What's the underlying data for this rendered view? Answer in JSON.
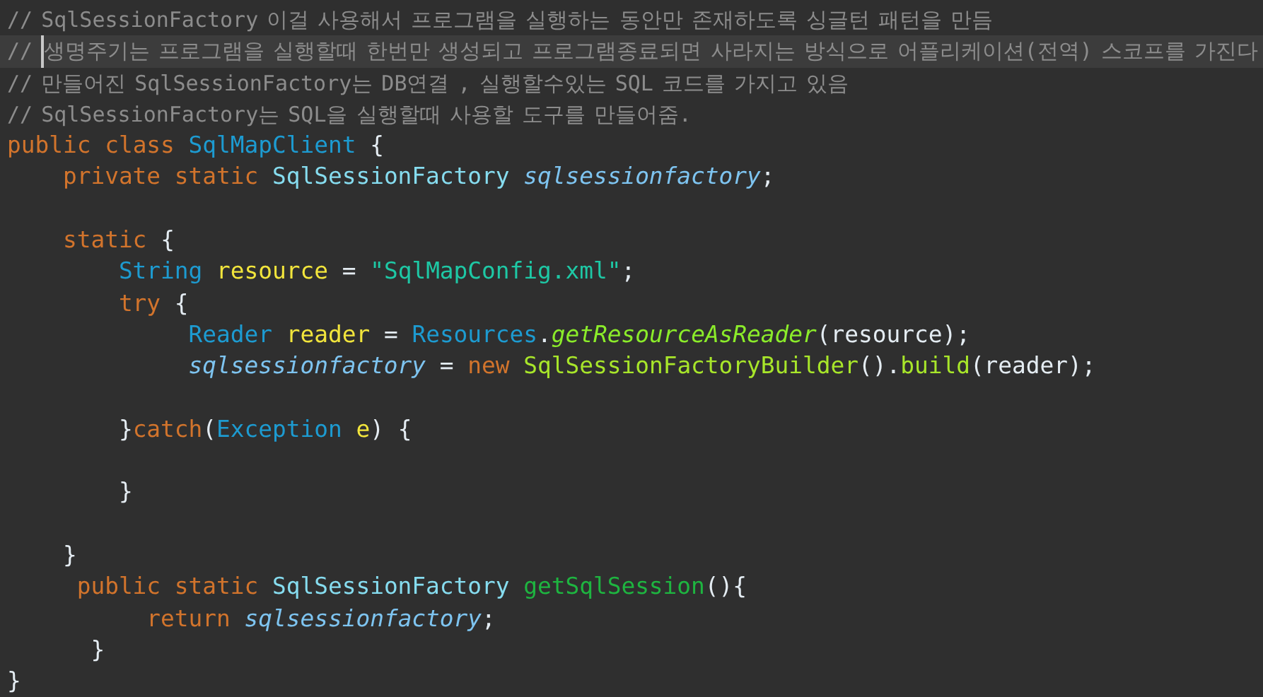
{
  "editor": {
    "lines": [
      {
        "kind": "code",
        "tokens": [
          {
            "text": "// SqlSessionFactory 이걸 사용해서 프로그램을 실행하는 동안만 존재하도록 싱글턴 패턴을 만듬",
            "kind": "comment"
          }
        ]
      },
      {
        "kind": "code",
        "current": true,
        "tokens": [
          {
            "text": "// ",
            "kind": "comment"
          },
          {
            "text": "생명주기는 프로그램을 실행할때 한번만 생성되고 프로그램종료되면 사라지는 방식으로 어플리케이션(전역) 스코프를 가진다",
            "kind": "comment",
            "caret": true
          }
        ]
      },
      {
        "kind": "code",
        "tokens": [
          {
            "text": "// 만들어진 SqlSessionFactory는 DB연결 , 실행할수있는 SQL 코드를 가지고 있음",
            "kind": "comment"
          }
        ]
      },
      {
        "kind": "code",
        "tokens": [
          {
            "text": "// SqlSessionFactory는 SQL을 실행할때 사용할 도구를 만들어줌.",
            "kind": "comment"
          }
        ]
      },
      {
        "kind": "code",
        "tokens": [
          {
            "text": "public ",
            "kind": "keyword"
          },
          {
            "text": "class ",
            "kind": "keyword"
          },
          {
            "text": "SqlMapClient",
            "kind": "class"
          },
          {
            "text": " {",
            "kind": "plain"
          }
        ]
      },
      {
        "kind": "code",
        "tokens": [
          {
            "text": "    private ",
            "kind": "keyword"
          },
          {
            "text": "static ",
            "kind": "keyword"
          },
          {
            "text": "SqlSessionFactory ",
            "kind": "interface"
          },
          {
            "text": "sqlsessionfactory",
            "kind": "field"
          },
          {
            "text": ";",
            "kind": "plain"
          }
        ]
      },
      {
        "kind": "blank"
      },
      {
        "kind": "code",
        "tokens": [
          {
            "text": "    static ",
            "kind": "keyword"
          },
          {
            "text": "{",
            "kind": "plain"
          }
        ]
      },
      {
        "kind": "code",
        "tokens": [
          {
            "text": "        String ",
            "kind": "class"
          },
          {
            "text": "resource",
            "kind": "variable"
          },
          {
            "text": " = ",
            "kind": "plain"
          },
          {
            "text": "\"SqlMapConfig.xml\"",
            "kind": "string"
          },
          {
            "text": ";",
            "kind": "plain"
          }
        ]
      },
      {
        "kind": "code",
        "tokens": [
          {
            "text": "        try ",
            "kind": "keyword"
          },
          {
            "text": "{",
            "kind": "plain"
          }
        ]
      },
      {
        "kind": "code",
        "tokens": [
          {
            "text": "             Reader ",
            "kind": "class"
          },
          {
            "text": "reader",
            "kind": "variable"
          },
          {
            "text": " = ",
            "kind": "plain"
          },
          {
            "text": "Resources",
            "kind": "class"
          },
          {
            "text": ".",
            "kind": "plain"
          },
          {
            "text": "getResourceAsReader",
            "kind": "static-method"
          },
          {
            "text": "(resource);",
            "kind": "plain"
          }
        ]
      },
      {
        "kind": "code",
        "tokens": [
          {
            "text": "             sqlsessionfactory",
            "kind": "field"
          },
          {
            "text": " = ",
            "kind": "plain"
          },
          {
            "text": "new ",
            "kind": "keyword"
          },
          {
            "text": "SqlSessionFactoryBuilder",
            "kind": "method"
          },
          {
            "text": "().",
            "kind": "plain"
          },
          {
            "text": "build",
            "kind": "method"
          },
          {
            "text": "(reader);",
            "kind": "plain"
          }
        ]
      },
      {
        "kind": "blank"
      },
      {
        "kind": "code",
        "tokens": [
          {
            "text": "        }",
            "kind": "plain"
          },
          {
            "text": "catch",
            "kind": "keyword"
          },
          {
            "text": "(",
            "kind": "plain"
          },
          {
            "text": "Exception ",
            "kind": "class"
          },
          {
            "text": "e",
            "kind": "variable"
          },
          {
            "text": ") {",
            "kind": "plain"
          }
        ]
      },
      {
        "kind": "blank"
      },
      {
        "kind": "code",
        "tokens": [
          {
            "text": "        }",
            "kind": "plain"
          }
        ]
      },
      {
        "kind": "blank"
      },
      {
        "kind": "code",
        "tokens": [
          {
            "text": "    }",
            "kind": "plain"
          }
        ]
      },
      {
        "kind": "code",
        "tokens": [
          {
            "text": "     public ",
            "kind": "keyword"
          },
          {
            "text": "static ",
            "kind": "keyword"
          },
          {
            "text": "SqlSessionFactory ",
            "kind": "interface"
          },
          {
            "text": "getSqlSession",
            "kind": "method-declaration"
          },
          {
            "text": "(){",
            "kind": "plain"
          }
        ]
      },
      {
        "kind": "code",
        "tokens": [
          {
            "text": "          return ",
            "kind": "keyword"
          },
          {
            "text": "sqlsessionfactory",
            "kind": "field"
          },
          {
            "text": ";",
            "kind": "plain"
          }
        ]
      },
      {
        "kind": "code",
        "tokens": [
          {
            "text": "      }",
            "kind": "plain"
          }
        ]
      },
      {
        "kind": "code",
        "tokens": [
          {
            "text": "}",
            "kind": "plain"
          }
        ]
      }
    ]
  }
}
